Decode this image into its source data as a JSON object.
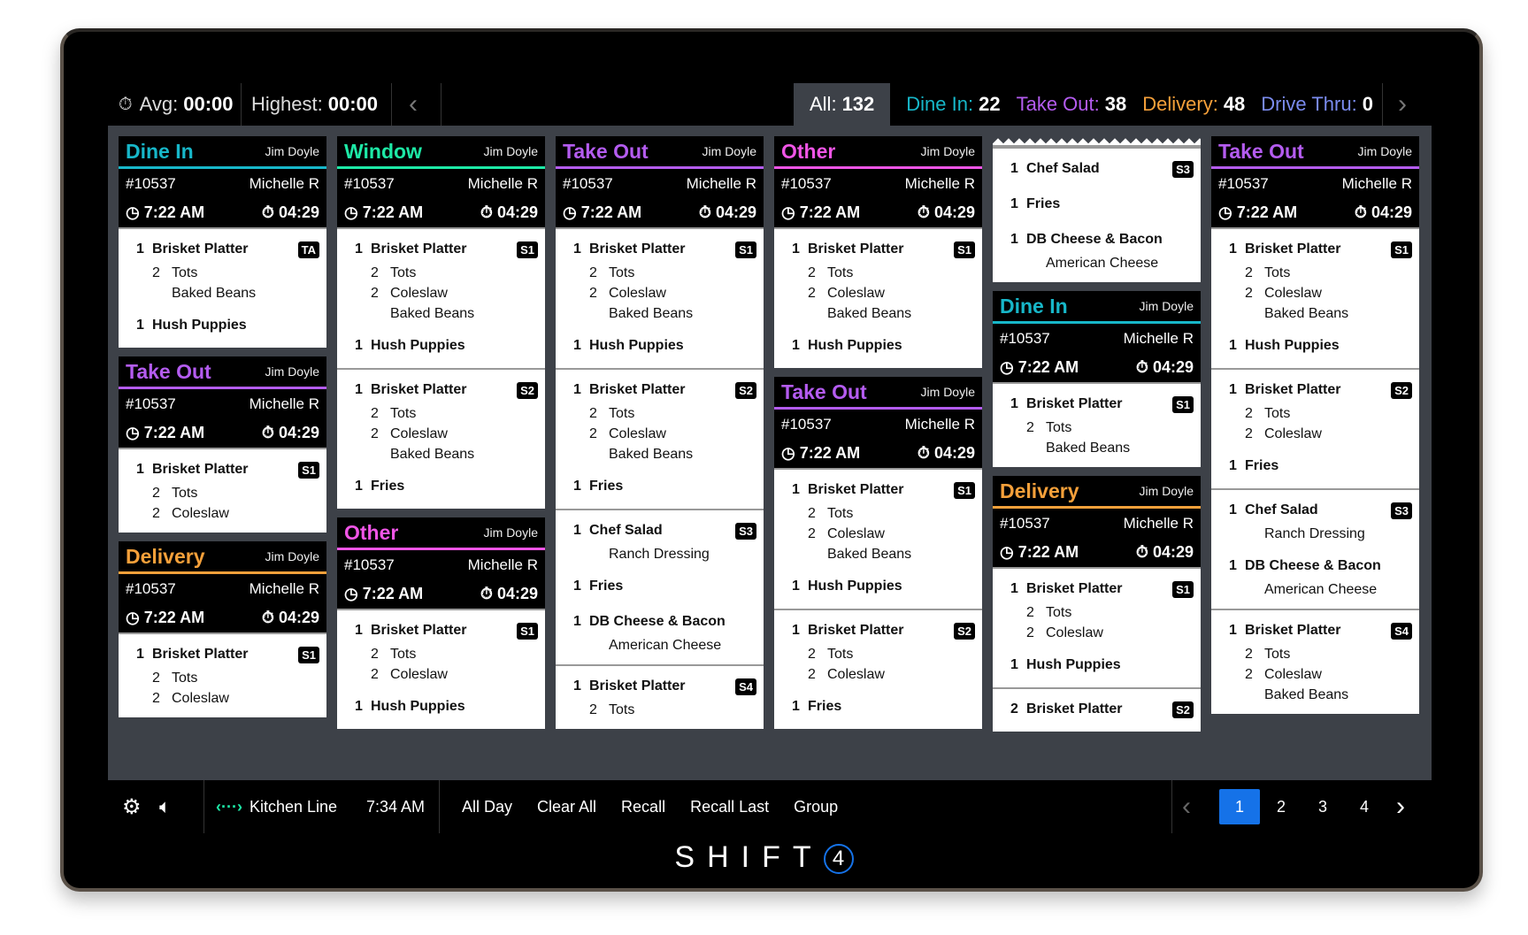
{
  "topbar": {
    "avg_label": "Avg:",
    "avg": "00:00",
    "highest_label": "Highest:",
    "highest": "00:00",
    "filters": [
      {
        "label": "All:",
        "count": "132",
        "color": "#ffffff"
      },
      {
        "label": "Dine In:",
        "count": "22",
        "color": "#17b7c9"
      },
      {
        "label": "Take Out:",
        "count": "38",
        "color": "#b45cf0"
      },
      {
        "label": "Delivery:",
        "count": "48",
        "color": "#f5a03a"
      },
      {
        "label": "Drive Thru:",
        "count": "0",
        "color": "#7b8cf0"
      }
    ]
  },
  "type_colors": {
    "Dine In": "#17b7c9",
    "Window": "#1de9a6",
    "Take Out": "#b45cf0",
    "Other": "#f055e6",
    "Delivery": "#f5a03a"
  },
  "columns": [
    [
      {
        "type": "Dine In",
        "server": "Jim Doyle",
        "order": "#10537",
        "guest": "Michelle R",
        "time": "7:22 AM",
        "elapsed": "04:29",
        "sections": [
          [
            {
              "qty": "1",
              "name": "Brisket Platter",
              "badge": "TA",
              "mods": [
                {
                  "qty": "2",
                  "name": "Tots"
                },
                {
                  "qty": "",
                  "name": "Baked Beans"
                }
              ]
            },
            {
              "qty": "1",
              "name": "Hush Puppies",
              "mods": []
            }
          ]
        ]
      },
      {
        "type": "Take Out",
        "server": "Jim Doyle",
        "order": "#10537",
        "guest": "Michelle R",
        "time": "7:22 AM",
        "elapsed": "04:29",
        "sections": [
          [
            {
              "qty": "1",
              "name": "Brisket Platter",
              "badge": "S1",
              "mods": [
                {
                  "qty": "2",
                  "name": "Tots"
                },
                {
                  "qty": "2",
                  "name": "Coleslaw"
                }
              ]
            }
          ]
        ]
      },
      {
        "type": "Delivery",
        "server": "Jim Doyle",
        "order": "#10537",
        "guest": "Michelle R",
        "time": "7:22 AM",
        "elapsed": "04:29",
        "sections": [
          [
            {
              "qty": "1",
              "name": "Brisket Platter",
              "badge": "S1",
              "mods": [
                {
                  "qty": "2",
                  "name": "Tots"
                },
                {
                  "qty": "2",
                  "name": "Coleslaw"
                }
              ]
            }
          ]
        ]
      }
    ],
    [
      {
        "type": "Window",
        "server": "Jim Doyle",
        "order": "#10537",
        "guest": "Michelle R",
        "time": "7:22 AM",
        "elapsed": "04:29",
        "sections": [
          [
            {
              "qty": "1",
              "name": "Brisket Platter",
              "badge": "S1",
              "mods": [
                {
                  "qty": "2",
                  "name": "Tots"
                },
                {
                  "qty": "2",
                  "name": "Coleslaw"
                },
                {
                  "qty": "",
                  "name": "Baked Beans"
                }
              ]
            },
            {
              "qty": "1",
              "name": "Hush Puppies",
              "mods": []
            }
          ],
          [
            {
              "qty": "1",
              "name": "Brisket Platter",
              "badge": "S2",
              "mods": [
                {
                  "qty": "2",
                  "name": "Tots"
                },
                {
                  "qty": "2",
                  "name": "Coleslaw"
                },
                {
                  "qty": "",
                  "name": "Baked Beans"
                }
              ]
            },
            {
              "qty": "1",
              "name": "Fries",
              "mods": []
            }
          ]
        ]
      },
      {
        "type": "Other",
        "server": "Jim Doyle",
        "order": "#10537",
        "guest": "Michelle R",
        "time": "7:22 AM",
        "elapsed": "04:29",
        "sections": [
          [
            {
              "qty": "1",
              "name": "Brisket Platter",
              "badge": "S1",
              "mods": [
                {
                  "qty": "2",
                  "name": "Tots"
                },
                {
                  "qty": "2",
                  "name": "Coleslaw"
                }
              ]
            },
            {
              "qty": "1",
              "name": "Hush Puppies",
              "mods": []
            }
          ]
        ]
      }
    ],
    [
      {
        "type": "Take Out",
        "server": "Jim Doyle",
        "order": "#10537",
        "guest": "Michelle R",
        "time": "7:22 AM",
        "elapsed": "04:29",
        "sections": [
          [
            {
              "qty": "1",
              "name": "Brisket Platter",
              "badge": "S1",
              "mods": [
                {
                  "qty": "2",
                  "name": "Tots"
                },
                {
                  "qty": "2",
                  "name": "Coleslaw"
                },
                {
                  "qty": "",
                  "name": "Baked Beans"
                }
              ]
            },
            {
              "qty": "1",
              "name": "Hush Puppies",
              "mods": []
            }
          ],
          [
            {
              "qty": "1",
              "name": "Brisket Platter",
              "badge": "S2",
              "mods": [
                {
                  "qty": "2",
                  "name": "Tots"
                },
                {
                  "qty": "2",
                  "name": "Coleslaw"
                },
                {
                  "qty": "",
                  "name": "Baked Beans"
                }
              ]
            },
            {
              "qty": "1",
              "name": "Fries",
              "mods": []
            }
          ],
          [
            {
              "qty": "1",
              "name": "Chef Salad",
              "badge": "S3",
              "mods": [
                {
                  "qty": "",
                  "name": "Ranch Dressing"
                }
              ]
            },
            {
              "qty": "1",
              "name": "Fries",
              "mods": []
            },
            {
              "qty": "1",
              "name": "DB Cheese & Bacon",
              "mods": [
                {
                  "qty": "",
                  "name": "American Cheese"
                }
              ]
            }
          ],
          [
            {
              "qty": "1",
              "name": "Brisket Platter",
              "badge": "S4",
              "mods": [
                {
                  "qty": "2",
                  "name": "Tots"
                }
              ]
            }
          ]
        ]
      }
    ],
    [
      {
        "type": "Other",
        "server": "Jim Doyle",
        "order": "#10537",
        "guest": "Michelle R",
        "time": "7:22 AM",
        "elapsed": "04:29",
        "sections": [
          [
            {
              "qty": "1",
              "name": "Brisket Platter",
              "badge": "S1",
              "mods": [
                {
                  "qty": "2",
                  "name": "Tots"
                },
                {
                  "qty": "2",
                  "name": "Coleslaw"
                },
                {
                  "qty": "",
                  "name": "Baked Beans"
                }
              ]
            },
            {
              "qty": "1",
              "name": "Hush Puppies",
              "mods": []
            }
          ]
        ]
      },
      {
        "type": "Take Out",
        "server": "Jim Doyle",
        "order": "#10537",
        "guest": "Michelle R",
        "time": "7:22 AM",
        "elapsed": "04:29",
        "sections": [
          [
            {
              "qty": "1",
              "name": "Brisket Platter",
              "badge": "S1",
              "mods": [
                {
                  "qty": "2",
                  "name": "Tots"
                },
                {
                  "qty": "2",
                  "name": "Coleslaw"
                },
                {
                  "qty": "",
                  "name": "Baked Beans"
                }
              ]
            },
            {
              "qty": "1",
              "name": "Hush Puppies",
              "mods": []
            }
          ],
          [
            {
              "qty": "1",
              "name": "Brisket Platter",
              "badge": "S2",
              "mods": [
                {
                  "qty": "2",
                  "name": "Tots"
                },
                {
                  "qty": "2",
                  "name": "Coleslaw"
                }
              ]
            },
            {
              "qty": "1",
              "name": "Fries",
              "mods": []
            }
          ]
        ]
      }
    ],
    [
      {
        "continuation": true,
        "sections": [
          [
            {
              "qty": "1",
              "name": "Chef Salad",
              "badge": "S3",
              "mods": []
            },
            {
              "qty": "1",
              "name": "Fries",
              "mods": []
            },
            {
              "qty": "1",
              "name": "DB Cheese & Bacon",
              "mods": [
                {
                  "qty": "",
                  "name": "American Cheese"
                }
              ]
            }
          ]
        ]
      },
      {
        "type": "Dine In",
        "server": "Jim Doyle",
        "order": "#10537",
        "guest": "Michelle R",
        "time": "7:22 AM",
        "elapsed": "04:29",
        "sections": [
          [
            {
              "qty": "1",
              "name": "Brisket Platter",
              "badge": "S1",
              "mods": [
                {
                  "qty": "2",
                  "name": "Tots"
                },
                {
                  "qty": "",
                  "name": "Baked Beans"
                }
              ]
            }
          ]
        ]
      },
      {
        "type": "Delivery",
        "server": "Jim Doyle",
        "order": "#10537",
        "guest": "Michelle R",
        "time": "7:22 AM",
        "elapsed": "04:29",
        "sections": [
          [
            {
              "qty": "1",
              "name": "Brisket Platter",
              "badge": "S1",
              "mods": [
                {
                  "qty": "2",
                  "name": "Tots"
                },
                {
                  "qty": "2",
                  "name": "Coleslaw"
                }
              ]
            },
            {
              "qty": "1",
              "name": "Hush Puppies",
              "mods": []
            }
          ],
          [
            {
              "qty": "2",
              "name": "Brisket Platter",
              "badge": "S2",
              "mods": []
            }
          ]
        ]
      }
    ],
    [
      {
        "type": "Take Out",
        "server": "Jim Doyle",
        "order": "#10537",
        "guest": "Michelle R",
        "time": "7:22 AM",
        "elapsed": "04:29",
        "sections": [
          [
            {
              "qty": "1",
              "name": "Brisket Platter",
              "badge": "S1",
              "mods": [
                {
                  "qty": "2",
                  "name": "Tots"
                },
                {
                  "qty": "2",
                  "name": "Coleslaw"
                },
                {
                  "qty": "",
                  "name": "Baked Beans"
                }
              ]
            },
            {
              "qty": "1",
              "name": "Hush Puppies",
              "mods": []
            }
          ],
          [
            {
              "qty": "1",
              "name": "Brisket Platter",
              "badge": "S2",
              "mods": [
                {
                  "qty": "2",
                  "name": "Tots"
                },
                {
                  "qty": "2",
                  "name": "Coleslaw"
                }
              ]
            },
            {
              "qty": "1",
              "name": "Fries",
              "mods": []
            }
          ],
          [
            {
              "qty": "1",
              "name": "Chef Salad",
              "badge": "S3",
              "mods": [
                {
                  "qty": "",
                  "name": "Ranch Dressing"
                }
              ]
            },
            {
              "qty": "1",
              "name": "DB Cheese & Bacon",
              "mods": [
                {
                  "qty": "",
                  "name": "American Cheese"
                }
              ]
            }
          ],
          [
            {
              "qty": "1",
              "name": "Brisket Platter",
              "badge": "S4",
              "mods": [
                {
                  "qty": "2",
                  "name": "Tots"
                },
                {
                  "qty": "2",
                  "name": "Coleslaw"
                },
                {
                  "qty": "",
                  "name": "Baked Beans"
                }
              ]
            }
          ]
        ]
      }
    ]
  ],
  "bottombar": {
    "station": "Kitchen Line",
    "clock": "7:34 AM",
    "actions": [
      "All Day",
      "Clear All",
      "Recall",
      "Recall Last",
      "Group"
    ],
    "pages": [
      "1",
      "2",
      "3",
      "4"
    ],
    "active_page": "1"
  },
  "brand": {
    "text": "SHIFT",
    "mark": "4",
    "accent": "#1572e8"
  }
}
